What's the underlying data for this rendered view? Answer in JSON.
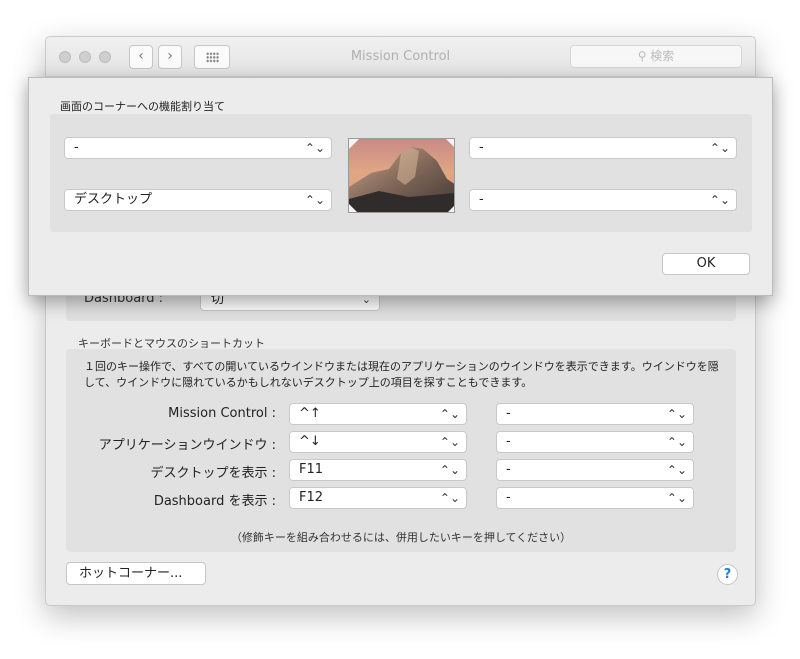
{
  "window": {
    "title": "Mission Control",
    "search_placeholder": "検索",
    "nav_back": "‹",
    "nav_forward": "›"
  },
  "dashboard": {
    "label": "Dashboard :",
    "value": "切"
  },
  "shortcuts": {
    "section_label": "キーボードとマウスのショートカット",
    "description": "１回のキー操作で、すべての開いているウインドウまたは現在のアプリケーションのウインドウを表示できます。ウインドウを隠して、ウインドウに隠れているかもしれないデスクトップ上の項目を探すこともできます。",
    "rows": [
      {
        "label": "Mission Control :",
        "key": "^↑",
        "mouse": "-"
      },
      {
        "label": "アプリケーションウインドウ :",
        "key": "^↓",
        "mouse": "-"
      },
      {
        "label": "デスクトップを表示 :",
        "key": "F11",
        "mouse": "-"
      },
      {
        "label": "Dashboard を表示 :",
        "key": "F12",
        "mouse": "-"
      }
    ],
    "note": "（修飾キーを組み合わせるには、併用したいキーを押してください）"
  },
  "buttons": {
    "hot_corners": "ホットコーナー...",
    "help": "?",
    "ok": "OK"
  },
  "sheet": {
    "title": "画面のコーナーへの機能割り当て",
    "top_left": "-",
    "top_right": "-",
    "bottom_left": "デスクトップ",
    "bottom_right": "-"
  }
}
